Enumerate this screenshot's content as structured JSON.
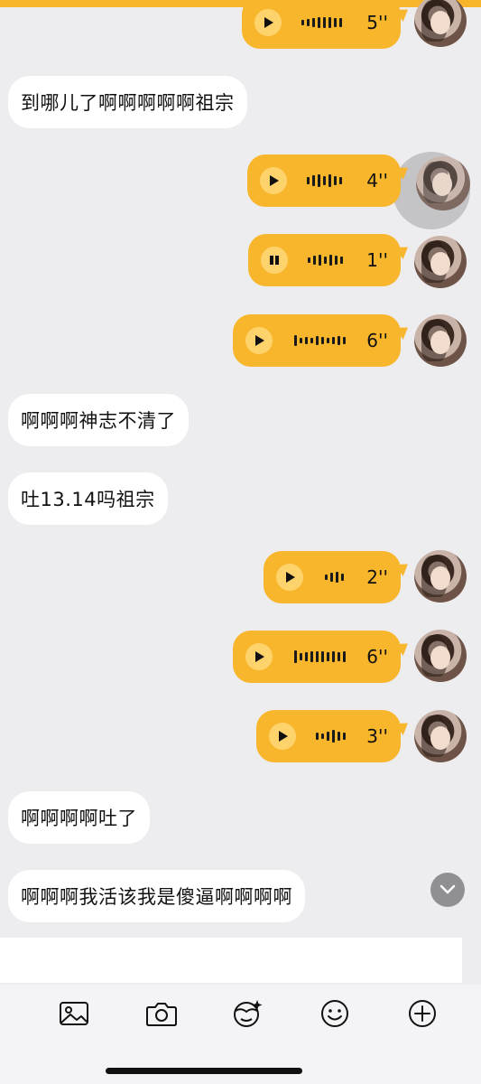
{
  "messages": {
    "m1": {
      "duration": "5''"
    },
    "m2": {
      "text": "到哪儿了啊啊啊啊啊祖宗"
    },
    "m3": {
      "duration": "4''"
    },
    "m4": {
      "duration": "1''"
    },
    "m5": {
      "duration": "6''"
    },
    "m6": {
      "text": "啊啊啊神志不清了"
    },
    "m7": {
      "text": "吐13.14吗祖宗"
    },
    "m8": {
      "duration": "2''"
    },
    "m9": {
      "duration": "6''"
    },
    "m10": {
      "duration": "3''"
    },
    "m11": {
      "text": "啊啊啊啊吐了"
    },
    "m12": {
      "text": "啊啊啊我活该我是傻逼啊啊啊啊"
    }
  },
  "toolbar": {
    "icons": [
      "image-icon",
      "camera-icon",
      "face-effect-icon",
      "emoji-icon",
      "add-icon"
    ]
  },
  "colors": {
    "voice_bubble": "#f8b62c",
    "incoming_bubble": "#ffffff",
    "background": "#ededf0"
  }
}
